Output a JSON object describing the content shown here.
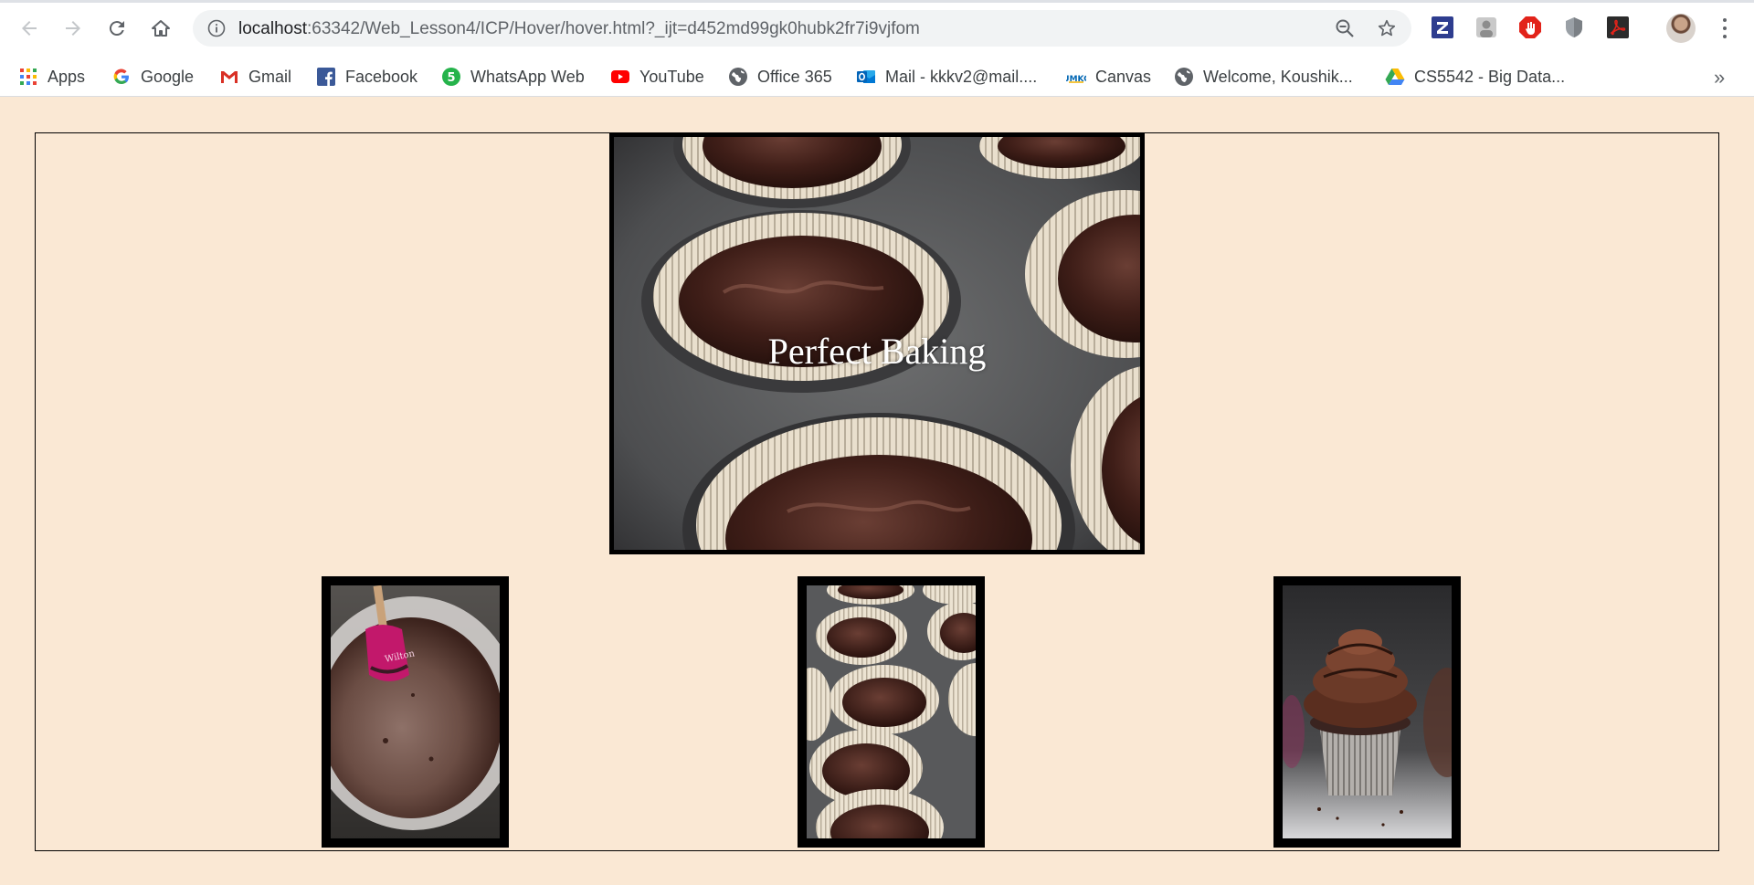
{
  "browser": {
    "url_host": "localhost",
    "url_rest": ":63342/Web_Lesson4/ICP/Hover/hover.html?_ijt=d452md99gk0hubk2fr7i9vjfom"
  },
  "bookmarks": [
    {
      "label": "Apps",
      "icon": "apps-grid-icon"
    },
    {
      "label": "Google",
      "icon": "google-icon"
    },
    {
      "label": "Gmail",
      "icon": "gmail-icon"
    },
    {
      "label": "Facebook",
      "icon": "facebook-icon"
    },
    {
      "label": "WhatsApp Web",
      "icon": "whatsapp-icon"
    },
    {
      "label": "YouTube",
      "icon": "youtube-icon"
    },
    {
      "label": "Office 365",
      "icon": "globe-icon"
    },
    {
      "label": "Mail - kkkv2@mail....",
      "icon": "outlook-icon"
    },
    {
      "label": "Canvas",
      "icon": "umkc-icon"
    },
    {
      "label": "Welcome, Koushik...",
      "icon": "globe-icon"
    },
    {
      "label": "CS5542 - Big Data...",
      "icon": "google-drive-icon"
    }
  ],
  "page": {
    "hero_caption": "Perfect Baking"
  },
  "colors": {
    "page_background": "#fae8d4",
    "frame_border": "#000000",
    "caption_text": "#ffffff"
  }
}
